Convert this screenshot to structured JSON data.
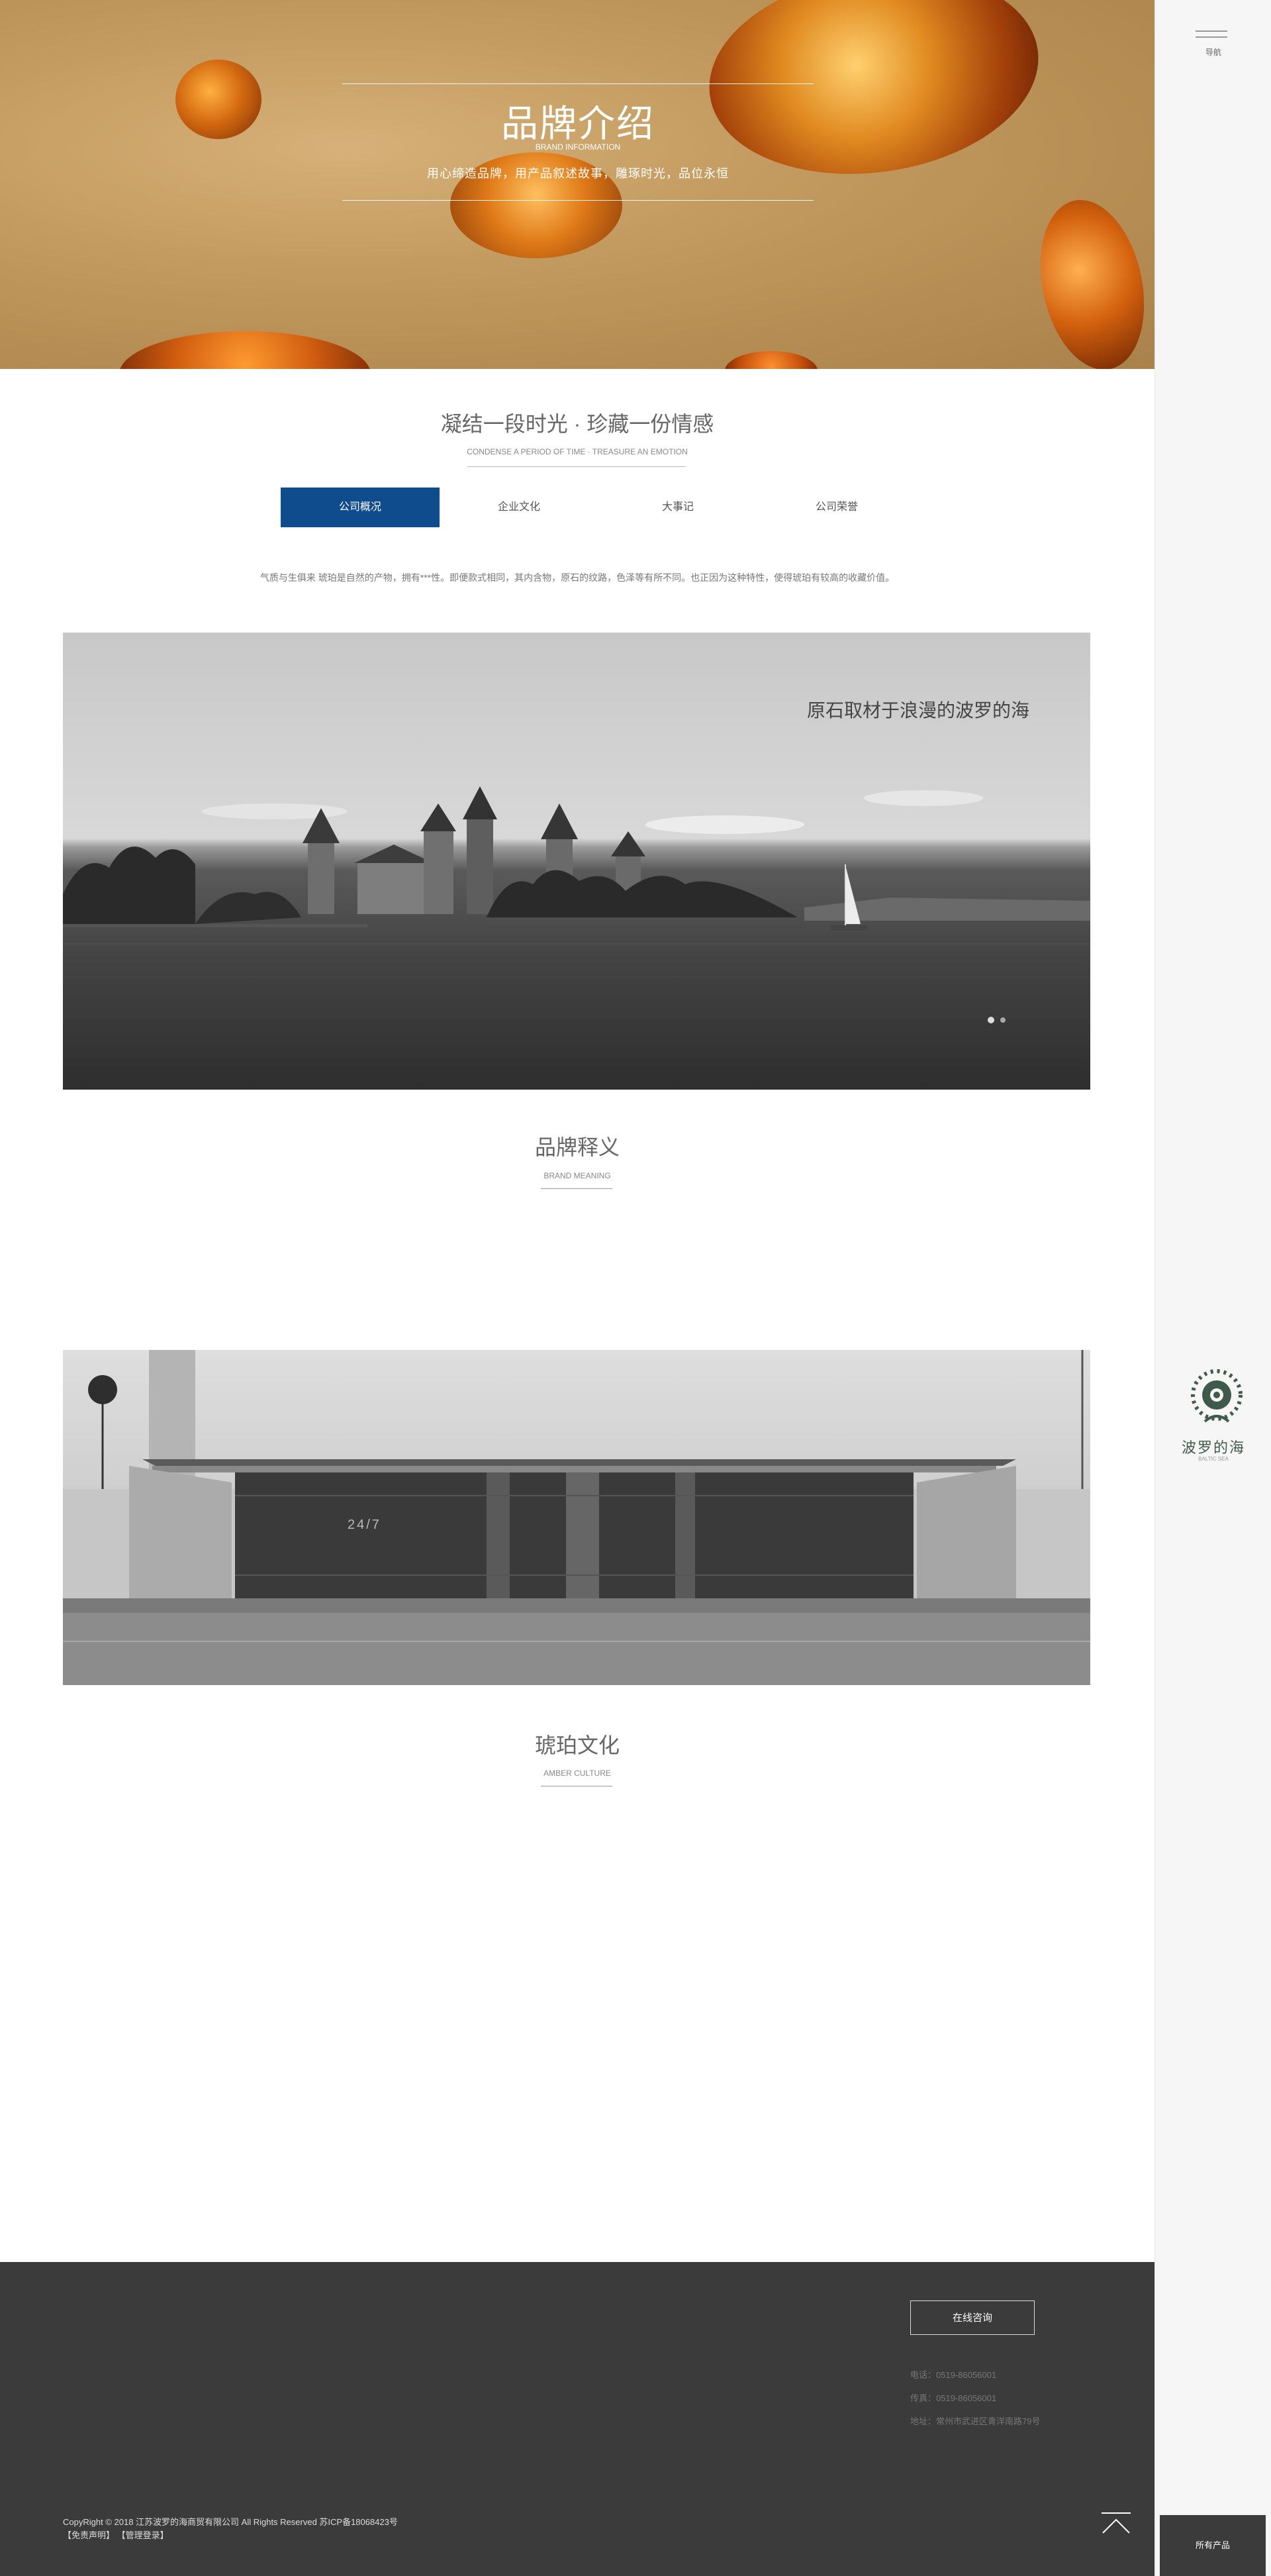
{
  "hero": {
    "title": "品牌介绍",
    "subtitle": "BRAND INFORMATION",
    "slogan": "用心缔造品牌，用产品叙述故事，雕琢时光，品位永恒"
  },
  "intro": {
    "title": "凝结一段时光 · 珍藏一份情感",
    "subtitle": "CONDENSE A PERIOD OF TIME · TREASURE AN EMOTION",
    "tabs": [
      {
        "label": "公司概况",
        "active": true
      },
      {
        "label": "企业文化",
        "active": false
      },
      {
        "label": "大事记",
        "active": false
      },
      {
        "label": "公司荣誉",
        "active": false
      }
    ],
    "description": "气质与生俱来 琥珀是自然的产物，拥有***性。即便款式相同，其内含物，原石的纹路，色泽等有所不同。也正因为这种特性，使得琥珀有较高的收藏价值。"
  },
  "brand_meaning": {
    "caption": "原石取材于浪漫的波罗的海",
    "title": "品牌释义",
    "subtitle": "BRAND MEANING"
  },
  "amber_culture": {
    "sign_text": "24/7",
    "title": "琥珀文化",
    "subtitle": "AMBER CULTURE"
  },
  "footer": {
    "consult_label": "在线咨询",
    "phone": "电话：0519-86056001",
    "fax": "传真：0519-86056001",
    "address": "地址：常州市武进区青洋南路79号",
    "copyright": "CopyRight © 2018 江苏波罗的海商贸有限公司 All Rights Reserved 苏ICP备18068423号",
    "links": "【免责声明】 【管理登录】"
  },
  "sidebar": {
    "nav_label": "导航",
    "logo_text": "波罗的海",
    "logo_sub": "BALTIC SEA",
    "products_label": "所有产品"
  },
  "colors": {
    "accent": "#0f4c8d",
    "footer_bg": "#3b3b3b",
    "sidebar_bg": "#f6f6f6"
  },
  "icons": [
    "menu-icon",
    "back-to-top-icon",
    "logo-icon"
  ]
}
